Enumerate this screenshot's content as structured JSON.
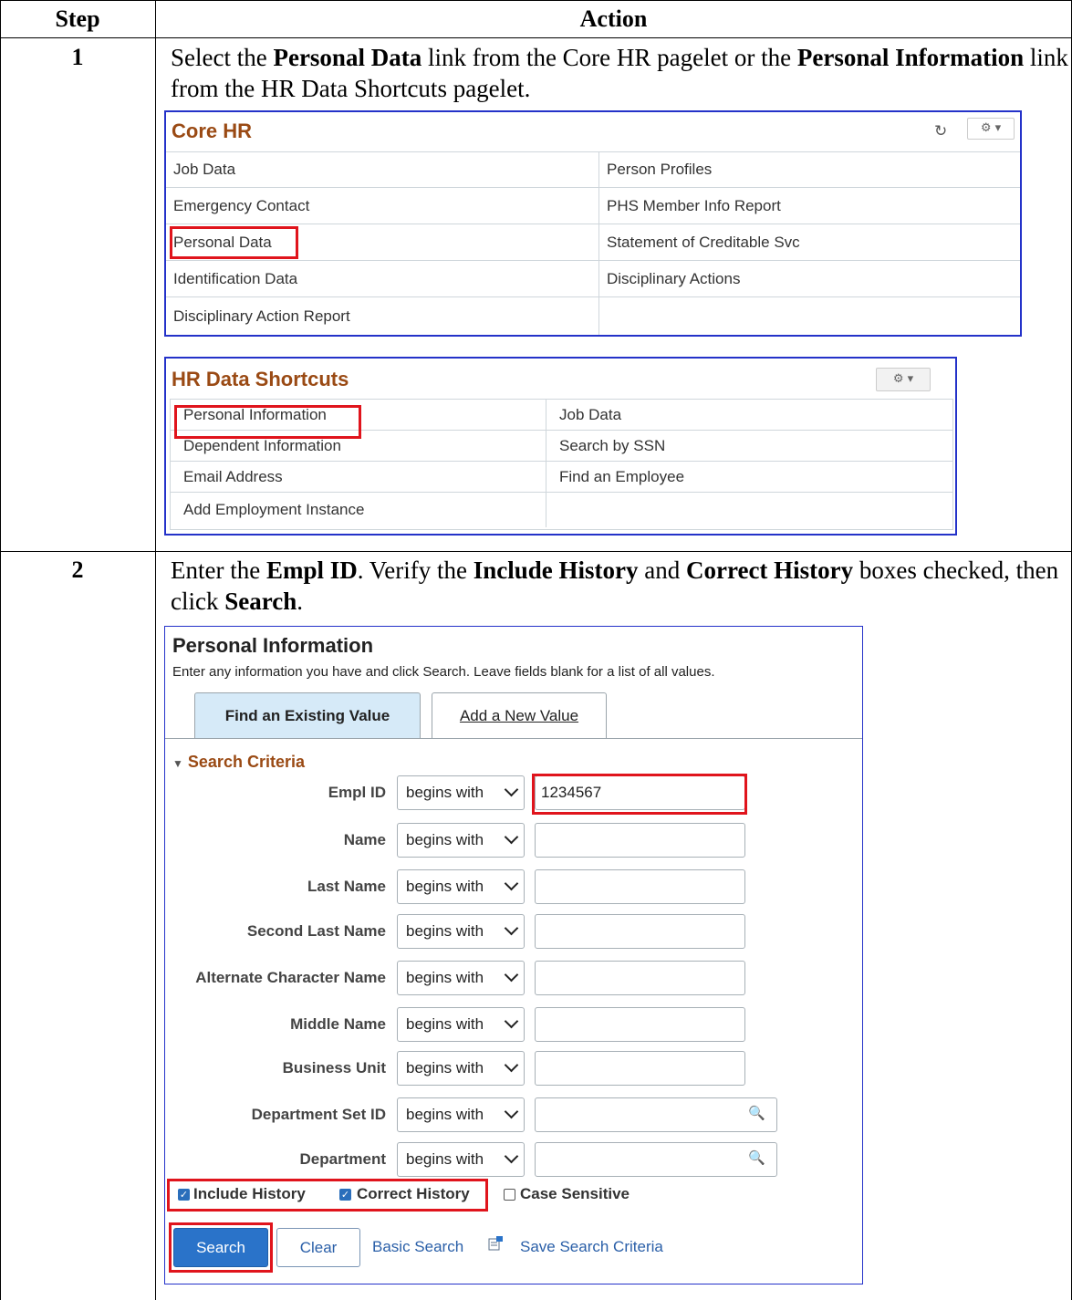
{
  "table": {
    "col_step": "Step",
    "col_action": "Action"
  },
  "step1": {
    "number": "1",
    "text_parts": [
      "Select the ",
      "Personal Data",
      " link from the Core HR pagelet or the ",
      "Personal Information",
      " link from the HR Data Shortcuts pagelet."
    ],
    "core_hr": {
      "title": "Core HR",
      "refresh_icon": "refresh-icon",
      "settings_icon": "gear-icon",
      "items": [
        "Job Data",
        "Person Profiles",
        "Emergency Contact",
        "PHS Member Info Report",
        "Personal Data",
        "Statement of Creditable Svc",
        "Identification Data",
        "Disciplinary Actions",
        "Disciplinary Action Report",
        ""
      ]
    },
    "hr_shortcuts": {
      "title": "HR Data Shortcuts",
      "settings_icon": "gear-icon",
      "items": [
        "Personal Information",
        "Job Data",
        "Dependent Information",
        "Search by SSN",
        "Email Address",
        "Find an Employee",
        "Add Employment Instance",
        ""
      ]
    }
  },
  "step2": {
    "number": "2",
    "text_parts": [
      "Enter the ",
      "Empl ID",
      ". Verify the ",
      "Include History",
      " and ",
      "Correct History",
      " boxes checked, then click ",
      "Search",
      "."
    ],
    "panel": {
      "title": "Personal Information",
      "subtitle": "Enter any information you have and click Search. Leave fields blank for a list of all values.",
      "tab_active": "Find an Existing Value",
      "tab_inactive": "Add a New Value",
      "section": "Search Criteria",
      "operator": "begins with",
      "fields": [
        {
          "label": "Empl ID",
          "value": "1234567"
        },
        {
          "label": "Name",
          "value": ""
        },
        {
          "label": "Last Name",
          "value": ""
        },
        {
          "label": "Second Last Name",
          "value": ""
        },
        {
          "label": "Alternate Character Name",
          "value": ""
        },
        {
          "label": "Middle Name",
          "value": ""
        },
        {
          "label": "Business Unit",
          "value": ""
        },
        {
          "label": "Department Set ID",
          "value": ""
        },
        {
          "label": "Department",
          "value": ""
        }
      ],
      "checkboxes": [
        {
          "label": "Include History",
          "checked": true
        },
        {
          "label": "Correct History",
          "checked": true
        },
        {
          "label": "Case Sensitive",
          "checked": false
        }
      ],
      "search_button": "Search",
      "clear_button": "Clear",
      "basic_search_link": "Basic Search",
      "save_search_link": "Save Search Criteria"
    }
  }
}
